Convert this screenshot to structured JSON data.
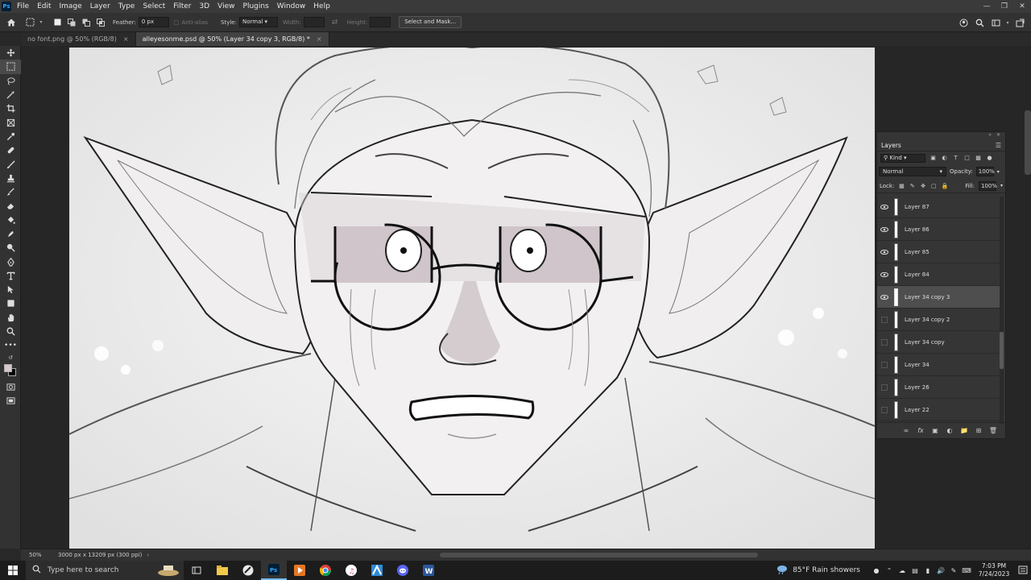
{
  "app": {
    "logo_text": "Ps"
  },
  "menu": [
    "File",
    "Edit",
    "Image",
    "Layer",
    "Type",
    "Select",
    "Filter",
    "3D",
    "View",
    "Plugins",
    "Window",
    "Help"
  ],
  "options": {
    "feather_label": "Feather:",
    "feather_value": "0 px",
    "antialias_label": "Anti-alias",
    "style_label": "Style:",
    "style_value": "Normal",
    "width_label": "Width:",
    "height_label": "Height:",
    "select_mask_label": "Select and Mask..."
  },
  "tabs": [
    {
      "label": "no font.png @ 50% (RGB/8)"
    },
    {
      "label": "alleyesonme.psd @ 50% (Layer 34 copy 3, RGB/8) *"
    }
  ],
  "layers_panel": {
    "title": "Layers",
    "filter_kind": "Kind",
    "blend_mode": "Normal",
    "opacity_label": "Opacity:",
    "opacity_value": "100%",
    "lock_label": "Lock:",
    "fill_label": "Fill:",
    "fill_value": "100%",
    "layers": [
      {
        "name": "Layer 87",
        "visible": true,
        "selected": false
      },
      {
        "name": "Layer 86",
        "visible": true,
        "selected": false
      },
      {
        "name": "Layer 85",
        "visible": true,
        "selected": false
      },
      {
        "name": "Layer 84",
        "visible": true,
        "selected": false
      },
      {
        "name": "Layer 34 copy 3",
        "visible": true,
        "selected": true
      },
      {
        "name": "Layer 34 copy 2",
        "visible": false,
        "selected": false
      },
      {
        "name": "Layer 34 copy",
        "visible": false,
        "selected": false
      },
      {
        "name": "Layer 34",
        "visible": false,
        "selected": false
      },
      {
        "name": "Layer 26",
        "visible": false,
        "selected": false
      },
      {
        "name": "Layer 22",
        "visible": false,
        "selected": false
      }
    ]
  },
  "status": {
    "zoom": "50%",
    "doc_info": "3000 px x 13209 px (300 ppi)"
  },
  "taskbar": {
    "search_placeholder": "Type here to search",
    "weather": "85°F  Rain showers",
    "time": "7:03 PM",
    "date": "7/24/2023"
  },
  "colors": {
    "foreground": "#d8c9cc",
    "background": "#000000",
    "accent": "#31a8ff"
  }
}
